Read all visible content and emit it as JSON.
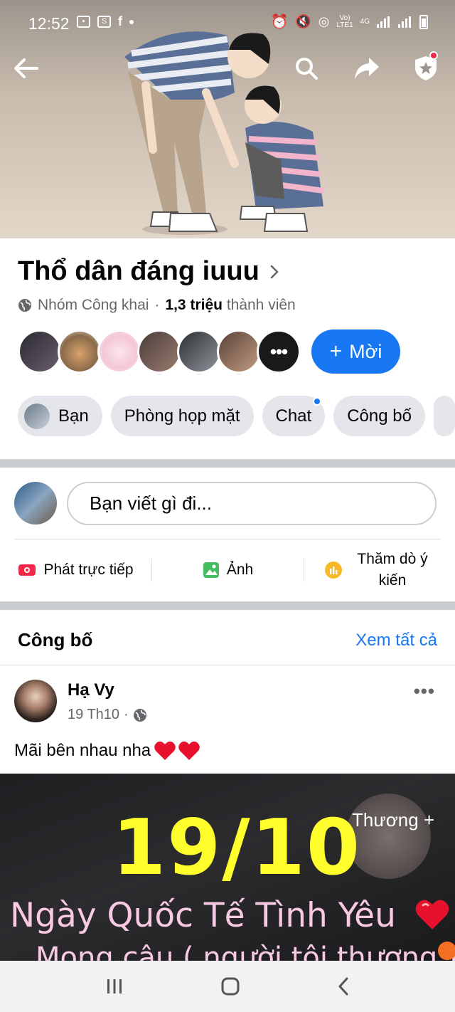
{
  "status_bar": {
    "time": "12:52",
    "network_top": "Vo)",
    "network_bottom": "LTE1",
    "network_type": "4G"
  },
  "header": {
    "back_icon": "arrow-left-icon",
    "search_icon": "search-icon",
    "share_icon": "share-icon",
    "admin_icon": "shield-star-icon"
  },
  "group": {
    "name": "Thổ dân đáng iuuu",
    "privacy": "Nhóm Công khai",
    "separator": "·",
    "member_count": "1,3 triệu",
    "member_label": "thành viên",
    "more_members": "•••",
    "invite_label": "Mời",
    "invite_plus": "+"
  },
  "chips": [
    {
      "label": "Bạn"
    },
    {
      "label": "Phòng họp mặt"
    },
    {
      "label": "Chat"
    },
    {
      "label": "Công bố"
    }
  ],
  "composer": {
    "placeholder": "Bạn viết gì đi...",
    "actions": {
      "live": "Phát trực tiếp",
      "photo": "Ảnh",
      "poll": "Thăm dò ý kiến"
    }
  },
  "announcements": {
    "title": "Công bố",
    "see_all": "Xem tất cả"
  },
  "post": {
    "author": "Hạ Vy",
    "time": "19 Th10",
    "separator": "·",
    "more": "•••",
    "text": "Mãi bên nhau nha",
    "image": {
      "date": "19/10",
      "line1": "Ngày Quốc Tế Tình Yêu",
      "line2": "Mong cậu ( người tôi thương )",
      "badge": "Thương +"
    }
  },
  "colors": {
    "brand": "#1877f2",
    "live_red": "#f02849",
    "photo_green": "#45bd62",
    "poll_orange": "#f7b928",
    "date_yellow": "#ffff2e"
  }
}
